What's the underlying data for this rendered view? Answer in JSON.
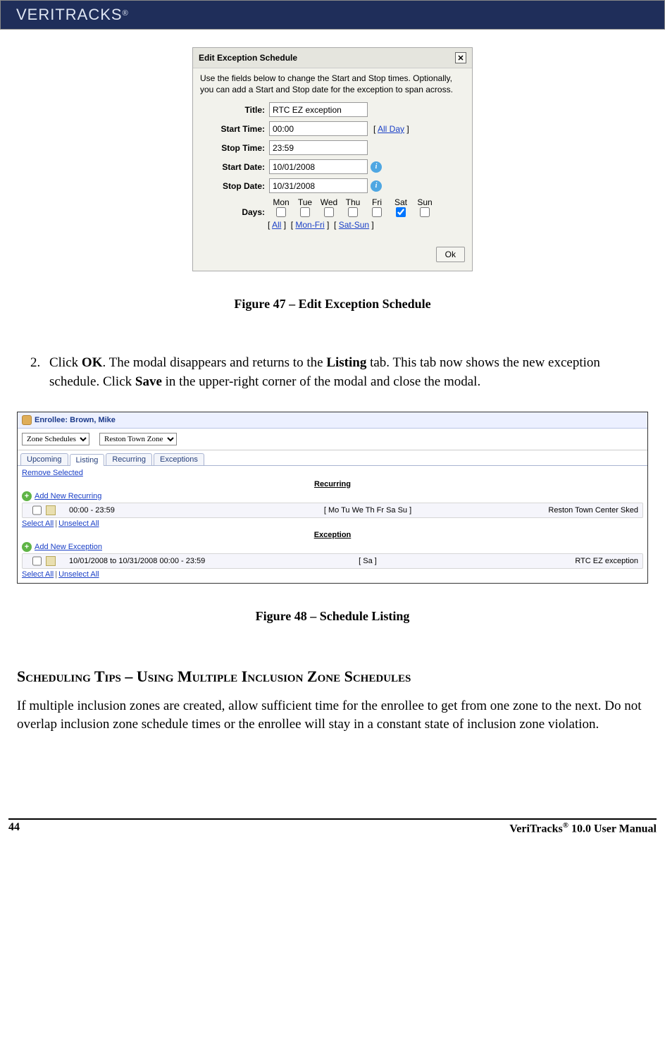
{
  "header": {
    "brand": "VERITRACKS",
    "reg": "®"
  },
  "modal": {
    "title": "Edit Exception Schedule",
    "desc": "Use the fields below to change the Start and Stop times. Optionally, you can add a Start and Stop date for the exception to span across.",
    "labels": {
      "title": "Title:",
      "start_time": "Start Time:",
      "stop_time": "Stop Time:",
      "start_date": "Start Date:",
      "stop_date": "Stop Date:",
      "days": "Days:"
    },
    "values": {
      "title": "RTC EZ exception",
      "start_time": "00:00",
      "stop_time": "23:59",
      "start_date": "10/01/2008",
      "stop_date": "10/31/2008"
    },
    "all_day": "All Day",
    "day_headers": [
      "Mon",
      "Tue",
      "Wed",
      "Thu",
      "Fri",
      "Sat",
      "Sun"
    ],
    "day_checked": [
      false,
      false,
      false,
      false,
      false,
      true,
      false
    ],
    "day_links": {
      "all": "All",
      "monfri": "Mon-Fri",
      "satsun": "Sat-Sun"
    },
    "ok": "Ok"
  },
  "fig47": "Figure 47 – Edit Exception Schedule",
  "step2": {
    "pre": "Click ",
    "ok": "OK",
    "mid": ". The modal disappears and returns to the ",
    "listing": "Listing",
    "mid2": " tab.  This tab now shows the new exception schedule. Click ",
    "save": "Save",
    "post": " in the upper-right corner of the modal and close the modal."
  },
  "listing": {
    "enrollee_label": "Enrollee: Brown, Mike",
    "select1": "Zone Schedules",
    "select2": "Reston Town Zone",
    "tabs": [
      "Upcoming",
      "Listing",
      "Recurring",
      "Exceptions"
    ],
    "remove": "Remove Selected",
    "recurring_head": "Recurring",
    "add_recurring": "Add New Recurring",
    "recurring_row": {
      "time": "00:00 - 23:59",
      "days": "[ Mo Tu We Th Fr Sa Su ]",
      "name": "Reston Town Center Sked"
    },
    "exception_head": "Exception",
    "add_exception": "Add New Exception",
    "exception_row": {
      "time": "10/01/2008 to 10/31/2008   00:00 - 23:59",
      "days": "[ Sa ]",
      "name": "RTC EZ exception"
    },
    "select_all": "Select All",
    "unselect_all": "Unselect All"
  },
  "fig48": "Figure 48 – Schedule Listing",
  "section_title": "Scheduling Tips – Using Multiple Inclusion Zone Schedules",
  "section_para": "If multiple inclusion zones are created, allow sufficient time for the enrollee to get from one zone to the next. Do not overlap inclusion zone schedule times or the enrollee will stay in a constant state of inclusion zone violation.",
  "footer": {
    "page": "44",
    "manual_pre": "VeriTracks",
    "manual_reg": "®",
    "manual_post": " 10.0 User Manual"
  }
}
